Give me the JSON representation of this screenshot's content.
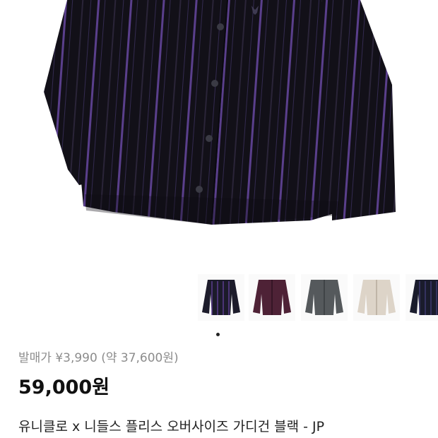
{
  "product": {
    "images": [
      {
        "icon": "cardigan-black-stripe-image",
        "color": "#1c1b2a",
        "stripe": "#5b3d8f"
      },
      {
        "icon": "cardigan-purple-image",
        "color": "#4e2236",
        "stripe": "#4e2236"
      },
      {
        "icon": "cardigan-gray-image",
        "color": "#55595c",
        "stripe": "#55595c"
      },
      {
        "icon": "cardigan-beige-image",
        "color": "#ddd4c8",
        "stripe": "#ddd4c8"
      },
      {
        "icon": "cardigan-navy-stripe-image",
        "color": "#1a1c2c",
        "stripe": "#3c3a70"
      }
    ],
    "original_price_label": "발매가 ¥3,990 (약 37,600원)",
    "price": "59,000원",
    "title": "유니클로 x 니들스 플리스 오버사이즈 가디건 블랙 - JP"
  },
  "colors": {
    "jacket_base": "#121018",
    "jacket_stripe": "#5a3f8c",
    "muted_text": "#8c8c8c"
  }
}
